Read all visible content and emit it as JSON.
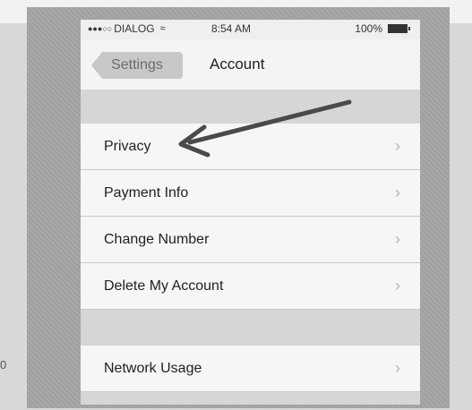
{
  "status_bar": {
    "carrier": "DIALOG",
    "time": "8:54 AM",
    "battery": "100%"
  },
  "nav": {
    "back_label": "Settings",
    "title": "Account"
  },
  "rows": [
    {
      "label": "Privacy"
    },
    {
      "label": "Payment Info"
    },
    {
      "label": "Change Number"
    },
    {
      "label": "Delete My Account"
    },
    {
      "label": "Network Usage"
    }
  ],
  "icons": {
    "signal": "signal-dots-icon",
    "wifi": "wifi-icon",
    "battery": "battery-icon",
    "chevron": "chevron-right-icon",
    "annotation": "hand-drawn-arrow-icon"
  },
  "page_mark": "0",
  "colors": {
    "nav_bg": "#f4f4f2",
    "section_gap": "#d6d6d4",
    "row_bg": "#f6f6f4",
    "back_button_bg": "#c8c8c6",
    "arrow": "#4a4a4a"
  }
}
